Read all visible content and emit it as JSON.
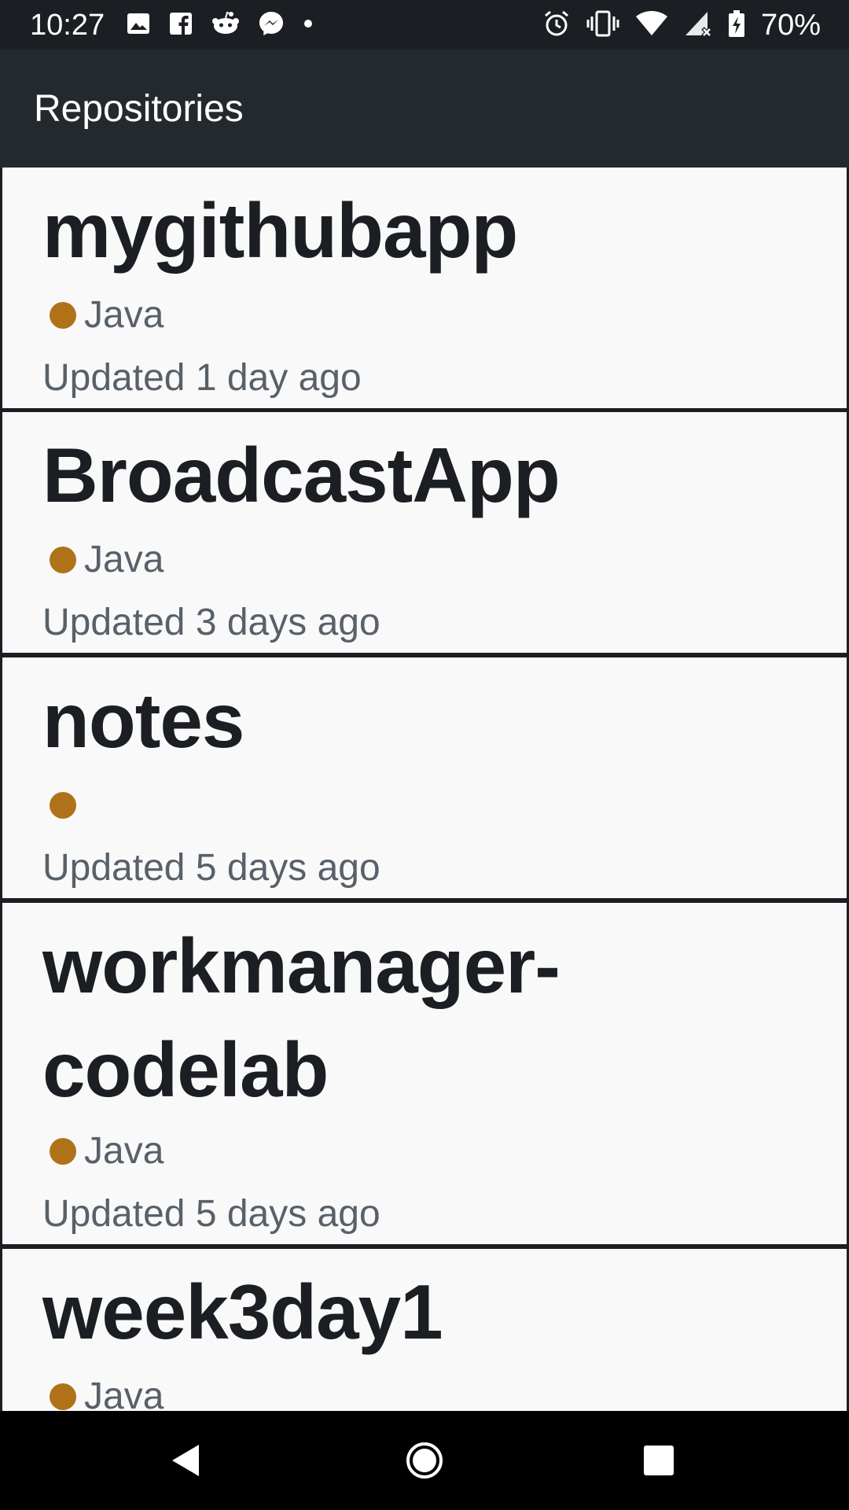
{
  "status_bar": {
    "time": "10:27",
    "battery": "70%",
    "left_icons": [
      "image-icon",
      "facebook-icon",
      "reddit-icon",
      "messenger-icon",
      "dot-icon"
    ],
    "right_icons": [
      "alarm-icon",
      "vibrate-icon",
      "wifi-icon",
      "signal-icon",
      "battery-icon"
    ]
  },
  "app_bar": {
    "title": "Repositories"
  },
  "repos": [
    {
      "name": "mygithubapp",
      "language": "Java",
      "updated": "Updated 1 day ago"
    },
    {
      "name": "BroadcastApp",
      "language": "Java",
      "updated": "Updated 3 days ago"
    },
    {
      "name": "notes",
      "language": "",
      "updated": "Updated 5 days ago"
    },
    {
      "name": "workmanager-\ncodelab",
      "language": "Java",
      "updated": "Updated 5 days ago"
    },
    {
      "name": "week3day1",
      "language": "Java",
      "updated": ""
    }
  ],
  "colors": {
    "language_dot": "#b07219",
    "app_bar_bg": "#24292e",
    "card_bg": "#f9f9f9"
  },
  "nav_bar": {
    "icons": [
      "back-icon",
      "home-icon",
      "recents-icon"
    ]
  }
}
